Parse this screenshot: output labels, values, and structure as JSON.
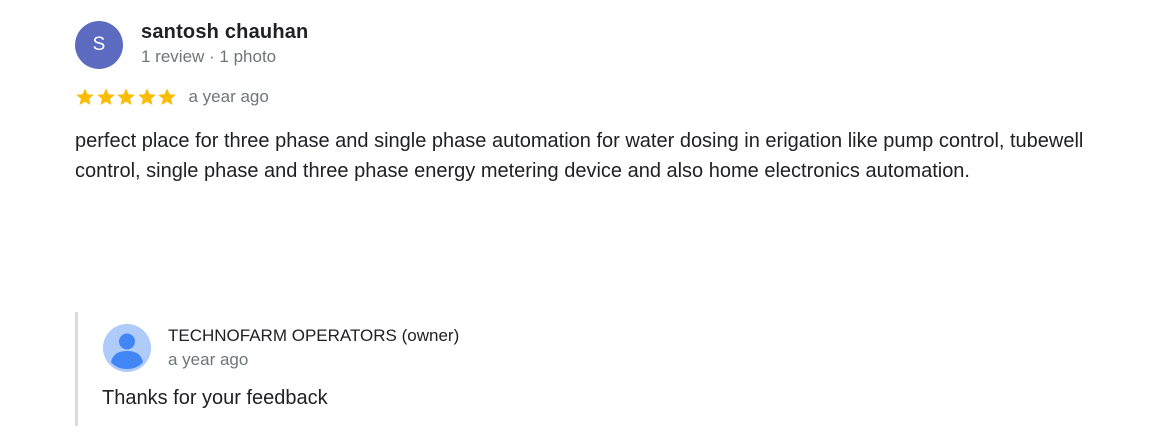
{
  "review": {
    "reviewer": {
      "initial": "S",
      "name": "santosh chauhan",
      "meta": "1 review · 1 photo",
      "avatar_color": "#5c6bc0"
    },
    "rating": {
      "stars": 5,
      "max_stars": 5,
      "star_color": "#fbbc04",
      "icon": "star-icon"
    },
    "time": "a year ago",
    "text": "perfect place for three phase and single phase automation for water dosing in erigation like pump control, tubewell control, single phase and three phase energy metering device and also home electronics automation."
  },
  "owner_reply": {
    "name": "TECHNOFARM OPERATORS (owner)",
    "time": "a year ago",
    "text": "Thanks for your feedback",
    "avatar_icon": "person-icon",
    "avatar_bg": "#aecbfa",
    "avatar_fg": "#4285f4"
  }
}
